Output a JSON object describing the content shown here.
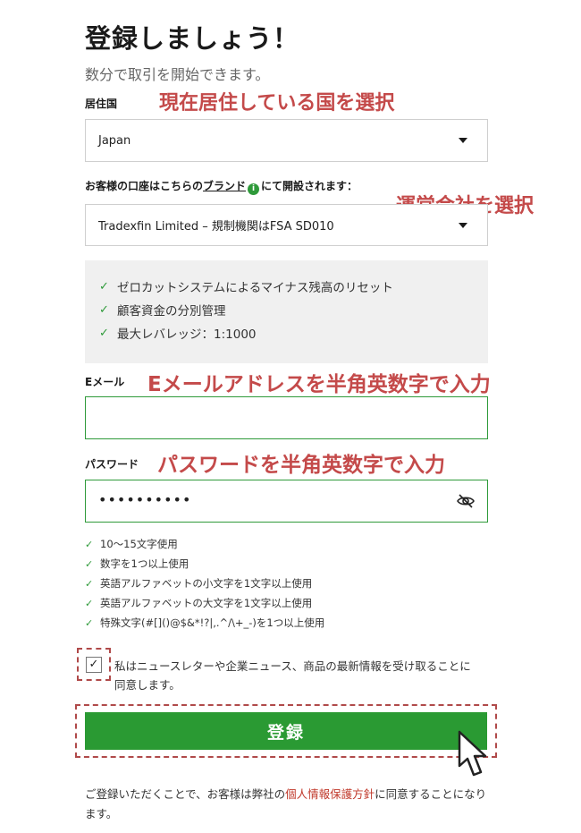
{
  "header": {
    "title": "登録しましょう！",
    "subtitle": "数分で取引を開始できます。"
  },
  "country": {
    "label": "居住国",
    "value": "Japan",
    "annotation": "現在居住している国を選択"
  },
  "brand": {
    "label_prefix": "お客様の口座はこちらの",
    "label_link": "ブランド",
    "label_suffix": "にて開設されます：",
    "value": "Tradexfin Limited – 規制機関はFSA SD010",
    "annotation": "運営会社を選択"
  },
  "features": [
    "ゼロカットシステムによるマイナス残高のリセット",
    "顧客資金の分別管理",
    "最大レバレッジ：1:1000"
  ],
  "email": {
    "label": "Eメール",
    "value": "",
    "annotation": "Eメールアドレスを半角英数字で入力"
  },
  "password": {
    "label": "パスワード",
    "value": "••••••••••",
    "annotation": "パスワードを半角英数字で入力"
  },
  "password_rules": [
    "10～15文字使用",
    "数字を1つ以上使用",
    "英語アルファベットの小文字を1文字以上使用",
    "英語アルファベットの大文字を1文字以上使用",
    "特殊文字(#[]()@$&*!?|,.^/\\+_-)を1つ以上使用"
  ],
  "newsletter": {
    "checked": true,
    "text": "私はニュースレターや企業ニュース、商品の最新情報を受け取ることに同意します。"
  },
  "submit": {
    "label": "登録"
  },
  "footer": {
    "prefix": "ご登録いただくことで、お客様は弊社の",
    "link": "個人情報保護方針",
    "suffix": "に同意することになります。"
  },
  "colors": {
    "accent_green": "#2a9a33",
    "annotation_red": "#c44a4a",
    "link_red": "#c0392b"
  },
  "icons": {
    "dropdown": "caret-down-icon",
    "info": "info-icon",
    "check": "check-icon",
    "password_toggle": "eye-slash-icon",
    "cursor": "mouse-pointer-icon"
  }
}
